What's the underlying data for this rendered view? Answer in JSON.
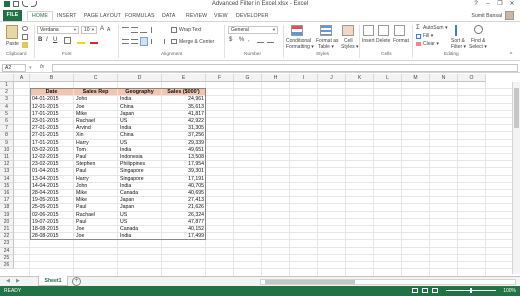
{
  "window": {
    "title": "Advanced Filter in Excel.xlsx - Excel",
    "controls": [
      "?",
      "–",
      "❐",
      "✕"
    ]
  },
  "tabs": [
    {
      "label": "FILE"
    },
    {
      "label": "HOME"
    },
    {
      "label": "INSERT"
    },
    {
      "label": "PAGE LAYOUT"
    },
    {
      "label": "FORMULAS"
    },
    {
      "label": "DATA"
    },
    {
      "label": "REVIEW"
    },
    {
      "label": "VIEW"
    },
    {
      "label": "DEVELOPER"
    }
  ],
  "active_tab": "HOME",
  "user": "Sumit Bansal",
  "ribbon": {
    "clipboard": {
      "group": "Clipboard",
      "paste": "Paste"
    },
    "font": {
      "group": "Font",
      "name": "Verdana",
      "size": "10",
      "bold": "B",
      "italic": "I",
      "underline": "U",
      "grow": "A",
      "shrink": "A"
    },
    "alignment": {
      "group": "Alignment",
      "wrap": "Wrap Text",
      "merge": "Merge & Center"
    },
    "number": {
      "group": "Number",
      "format": "General",
      "currency": "$",
      "percent": "%",
      "comma": ","
    },
    "styles": {
      "group": "Styles",
      "conditional": "Conditional",
      "conditional2": "Formatting ▾",
      "format_table": "Format as",
      "format_table2": "Table ▾",
      "cell_styles": "Cell",
      "cell_styles2": "Styles ▾"
    },
    "cells": {
      "group": "Cells",
      "insert": "Insert",
      "delete": "Delete",
      "format": "Format"
    },
    "editing": {
      "group": "Editing",
      "autosum": "AutoSum ▾",
      "fill": "Fill ▾",
      "clear": "Clear ▾",
      "sort": "Sort &",
      "sort2": "Filter ▾",
      "find": "Find &",
      "find2": "Select ▾"
    }
  },
  "formula_bar": {
    "name_box": "A2",
    "fx": "fx",
    "content": ""
  },
  "columns": [
    "A",
    "B",
    "C",
    "D",
    "E",
    "F",
    "G",
    "H",
    "I",
    "J",
    "K",
    "L",
    "M",
    "N",
    "O"
  ],
  "rows": [
    "1",
    "2",
    "3",
    "4",
    "5",
    "6",
    "7",
    "8",
    "9",
    "10",
    "11",
    "12",
    "13",
    "14",
    "15",
    "16",
    "17",
    "18",
    "19",
    "20",
    "21",
    "22",
    "23",
    "24",
    "25",
    "26"
  ],
  "table": {
    "headers": [
      "Date",
      "Sales Rep",
      "Geography",
      "Sales ($000')"
    ],
    "rows": [
      [
        "04-01-2015",
        "John",
        "India",
        "24,961"
      ],
      [
        "12-01-2015",
        "Joe",
        "China",
        "35,613"
      ],
      [
        "17-01-2015",
        "Mike",
        "Japan",
        "41,817"
      ],
      [
        "23-01-2015",
        "Rachael",
        "US",
        "42,922"
      ],
      [
        "27-01-2015",
        "Arvind",
        "India",
        "31,305"
      ],
      [
        "27-01-2015",
        "Xin",
        "China",
        "37,256"
      ],
      [
        "17-01-2015",
        "Harry",
        "US",
        "29,339"
      ],
      [
        "03-02-2015",
        "Tom",
        "India",
        "49,651"
      ],
      [
        "12-02-2015",
        "Paul",
        "Indonesia",
        "13,508"
      ],
      [
        "23-02-2015",
        "Stephen",
        "Philippines",
        "17,954"
      ],
      [
        "01-04-2015",
        "Paul",
        "Singapore",
        "39,301"
      ],
      [
        "13-04-2015",
        "Harry",
        "Singapore",
        "17,191"
      ],
      [
        "14-04-2015",
        "John",
        "India",
        "40,705"
      ],
      [
        "28-04-2015",
        "Mike",
        "Canada",
        "40,695"
      ],
      [
        "19-05-2015",
        "Mike",
        "Japan",
        "27,413"
      ],
      [
        "25-05-2015",
        "Paul",
        "Japan",
        "21,626"
      ],
      [
        "02-06-2015",
        "Rachael",
        "US",
        "26,324"
      ],
      [
        "19-07-2015",
        "Paul",
        "US",
        "47,877"
      ],
      [
        "18-08-2015",
        "Joe",
        "Canada",
        "40,152"
      ],
      [
        "28-08-2015",
        "Joe",
        "India",
        "17,499"
      ]
    ]
  },
  "sheet_tab": "Sheet1",
  "status": {
    "ready": "READY",
    "zoom": "100%"
  },
  "colors": {
    "excel_green": "#217346",
    "header_fill": "#f2c5b0"
  }
}
